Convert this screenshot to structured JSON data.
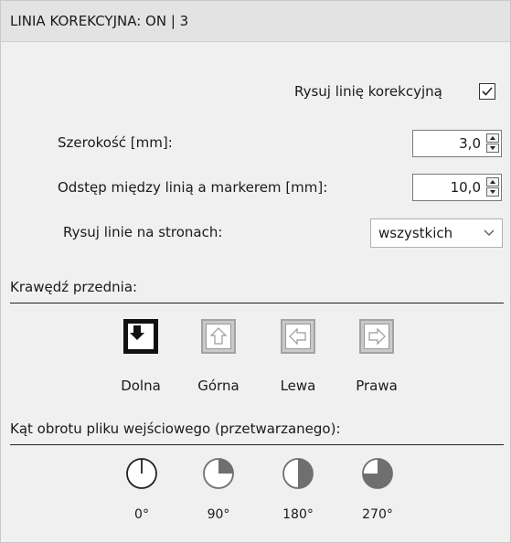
{
  "header": {
    "title": "LINIA KOREKCYJNA: ON | 3"
  },
  "draw_line": {
    "label": "Rysuj linię korekcyjną",
    "checked": true
  },
  "width_field": {
    "label": "Szerokość [mm]:",
    "value": "3,0"
  },
  "spacing_field": {
    "label": "Odstęp między linią a markerem [mm]:",
    "value": "10,0"
  },
  "pages_field": {
    "label": "Rysuj linie na stronach:",
    "value": "wszystkich"
  },
  "front_edge": {
    "title": "Krawędź przednia:",
    "options": [
      {
        "label": "Dolna",
        "icon": "arrow-down-icon",
        "selected": true
      },
      {
        "label": "Górna",
        "icon": "arrow-up-icon",
        "selected": false
      },
      {
        "label": "Lewa",
        "icon": "arrow-left-icon",
        "selected": false
      },
      {
        "label": "Prawa",
        "icon": "arrow-right-icon",
        "selected": false
      }
    ]
  },
  "rotation": {
    "title": "Kąt obrotu pliku wejściowego (przetwarzanego):",
    "options": [
      {
        "label": "0°",
        "icon": "rotation-0-icon"
      },
      {
        "label": "90°",
        "icon": "rotation-90-icon"
      },
      {
        "label": "180°",
        "icon": "rotation-180-icon"
      },
      {
        "label": "270°",
        "icon": "rotation-270-icon"
      }
    ]
  },
  "colors": {
    "header_bg": "#e3e3e3",
    "panel_bg": "#f0f0f0",
    "selected_icon": "#111111",
    "pie_fill": "#6f6f6f"
  }
}
